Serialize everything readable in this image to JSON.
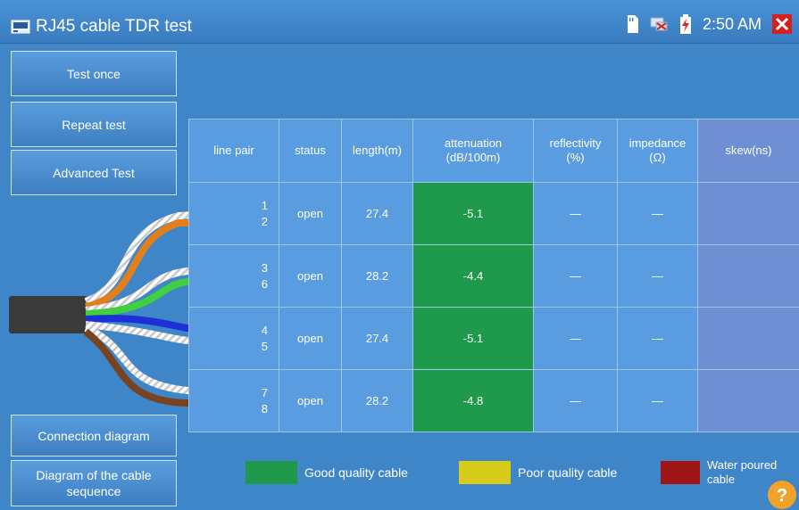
{
  "header": {
    "title": "RJ45 cable TDR test",
    "time": "2:50 AM",
    "icons": [
      "sd-card-icon",
      "network-icon",
      "battery-charging-icon",
      "close-icon"
    ]
  },
  "sidebar": {
    "test_once": "Test once",
    "repeat_test": "Repeat test",
    "advanced_test": "Advanced Test",
    "connection_diagram": "Connection diagram",
    "cable_sequence": "Diagram of the cable sequence"
  },
  "table": {
    "headers": {
      "line_pair": "line pair",
      "status": "status",
      "length": "length(m)",
      "attenuation_1": "attenuation",
      "attenuation_2": "(dB/100m)",
      "reflectivity_1": "reflectivity",
      "reflectivity_2": "(%)",
      "impedance_1": "impedance",
      "impedance_2": "(Ω)",
      "skew": "skew(ns)"
    },
    "rows": [
      {
        "pair_a": "1",
        "pair_b": "2",
        "status": "open",
        "length": "27.4",
        "attenuation": "-5.1",
        "reflectivity": "—",
        "impedance": "—",
        "skew": ""
      },
      {
        "pair_a": "3",
        "pair_b": "6",
        "status": "open",
        "length": "28.2",
        "attenuation": "-4.4",
        "reflectivity": "—",
        "impedance": "—",
        "skew": ""
      },
      {
        "pair_a": "4",
        "pair_b": "5",
        "status": "open",
        "length": "27.4",
        "attenuation": "-5.1",
        "reflectivity": "—",
        "impedance": "—",
        "skew": ""
      },
      {
        "pair_a": "7",
        "pair_b": "8",
        "status": "open",
        "length": "28.2",
        "attenuation": "-4.8",
        "reflectivity": "—",
        "impedance": "—",
        "skew": ""
      }
    ]
  },
  "legend": {
    "good": "Good quality cable",
    "poor": "Poor quality cable",
    "water_1": "Water poured",
    "water_2": "cable"
  },
  "colors": {
    "background": "#3f86c9",
    "good": "#1f9a4c",
    "poor": "#d8cc1a",
    "water": "#a01616",
    "pair1": "#e07f1c",
    "pair2": "#3fcf3f",
    "pair3": "#1d2fd6",
    "pair4": "#7a4320"
  }
}
